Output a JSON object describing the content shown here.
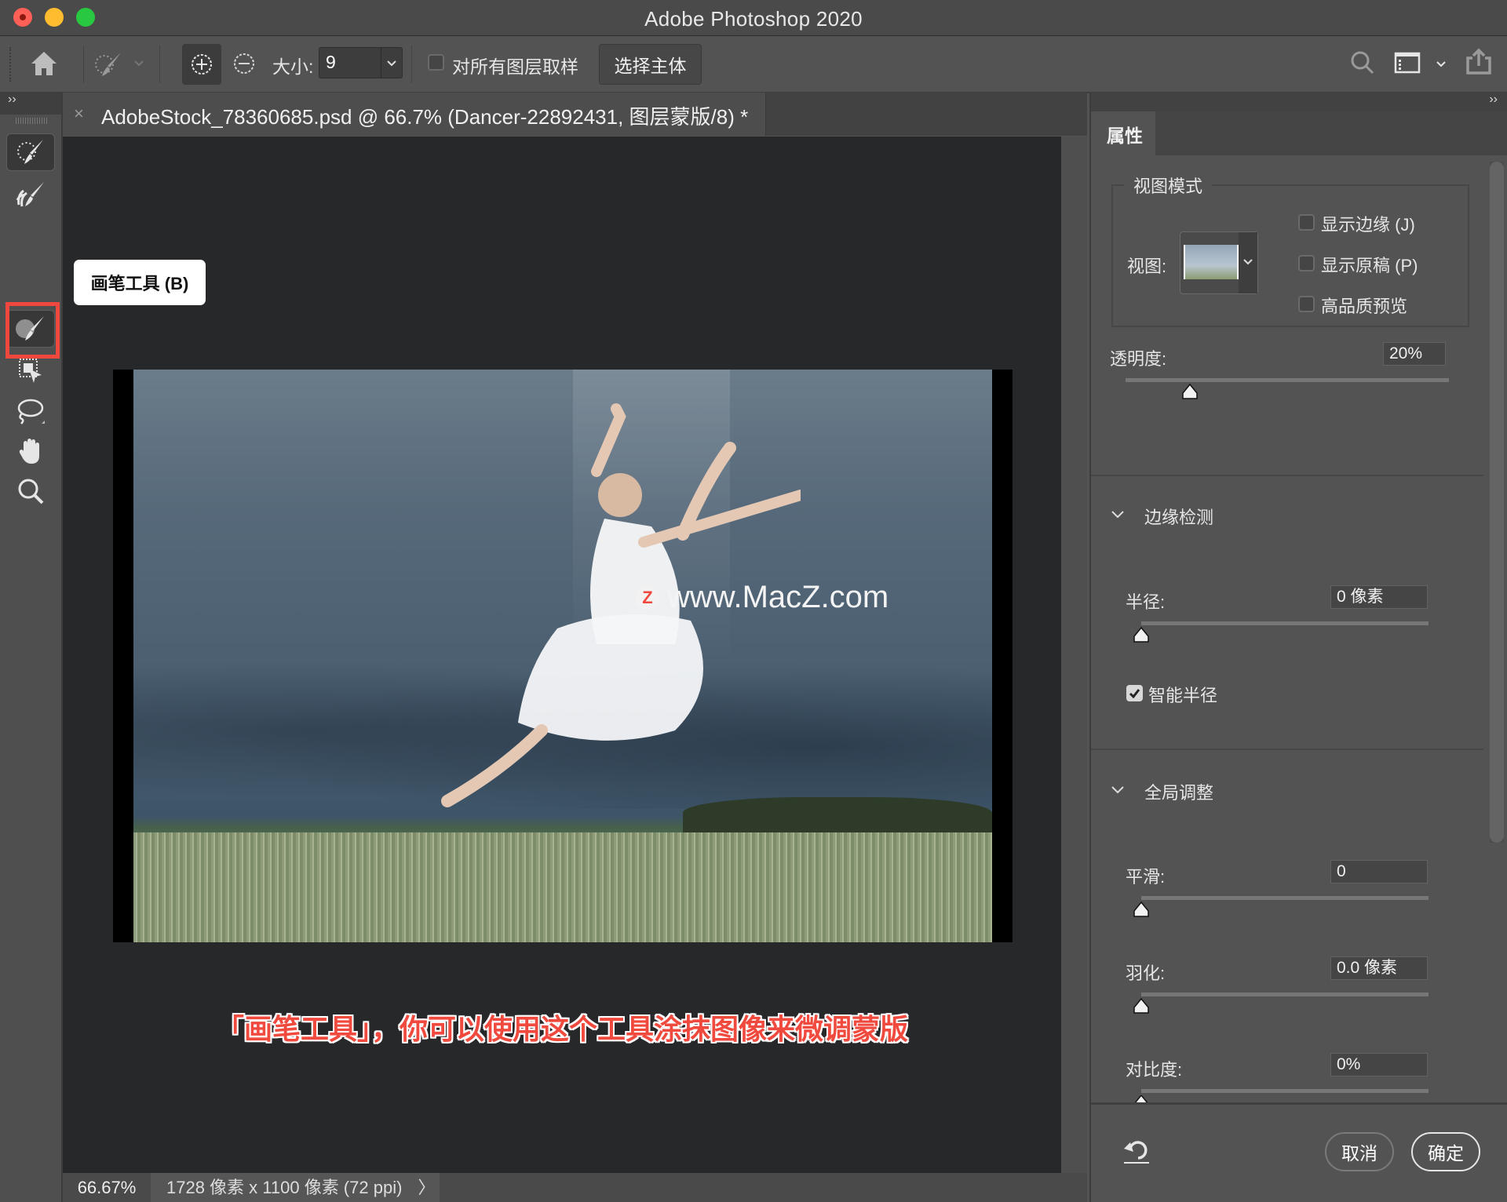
{
  "window": {
    "title": "Adobe Photoshop 2020",
    "traffic_lights": {
      "close": "#fe5f57",
      "minimize": "#febc2e",
      "zoom": "#28c840"
    }
  },
  "options_bar": {
    "home_icon": "home-icon",
    "tool_preset_icon": "quick-selection-brush-icon",
    "add_mode_icon": "add-to-selection-icon",
    "subtract_mode_icon": "subtract-from-selection-icon",
    "size_label": "大小:",
    "size_value": "9",
    "sample_all_layers_label": "对所有图层取样",
    "sample_all_layers_checked": false,
    "select_subject_button": "选择主体",
    "search_icon": "search-icon",
    "workspace_icon": "workspace-icon",
    "share_icon": "share-icon"
  },
  "document_tab": {
    "close_glyph": "×",
    "title": "AdobeStock_78360685.psd @ 66.7% (Dancer-22892431, 图层蒙版/8) *"
  },
  "tools": [
    {
      "name": "quick-selection-tool",
      "selected": true
    },
    {
      "name": "refine-edge-brush-tool",
      "selected": false
    },
    {
      "name": "brush-tool",
      "selected": true,
      "highlighted": true
    },
    {
      "name": "object-selection-tool",
      "selected": false
    },
    {
      "name": "lasso-tool",
      "selected": false
    },
    {
      "name": "hand-tool",
      "selected": false
    },
    {
      "name": "zoom-tool",
      "selected": false
    }
  ],
  "tooltip": {
    "text": "画笔工具 (B)"
  },
  "canvas": {
    "watermark": "www.MacZ.com",
    "watermark_logo": "Z",
    "caption": "「画笔工具」，你可以使用这个工具涂抹图像来微调蒙版",
    "caption_color": "#f04a3e",
    "highlight_color": "#f0483e"
  },
  "status_bar": {
    "zoom": "66.67%",
    "doc_info": "1728 像素 x 1100 像素 (72 ppi)",
    "arrow": "〉"
  },
  "properties": {
    "tab_label": "属性",
    "view_mode": {
      "group_label": "视图模式",
      "view_label": "视图:",
      "options": [
        {
          "label": "显示边缘 (J)",
          "checked": false
        },
        {
          "label": "显示原稿 (P)",
          "checked": false
        },
        {
          "label": "高品质预览",
          "checked": false
        }
      ]
    },
    "opacity": {
      "label": "透明度:",
      "value": "20%",
      "fraction": 0.2
    },
    "edge_detection": {
      "title": "边缘检测",
      "radius_label": "半径:",
      "radius_value": "0 像素",
      "radius_fraction": 0,
      "smart_radius_label": "智能半径",
      "smart_radius_checked": true
    },
    "global_refinements": {
      "title": "全局调整",
      "smooth_label": "平滑:",
      "smooth_value": "0",
      "smooth_fraction": 0,
      "feather_label": "羽化:",
      "feather_value": "0.0 像素",
      "feather_fraction": 0,
      "contrast_label": "对比度:",
      "contrast_value": "0%",
      "contrast_fraction": 0
    },
    "footer": {
      "reset_icon": "reset-icon",
      "cancel_label": "取消",
      "ok_label": "确定"
    }
  }
}
